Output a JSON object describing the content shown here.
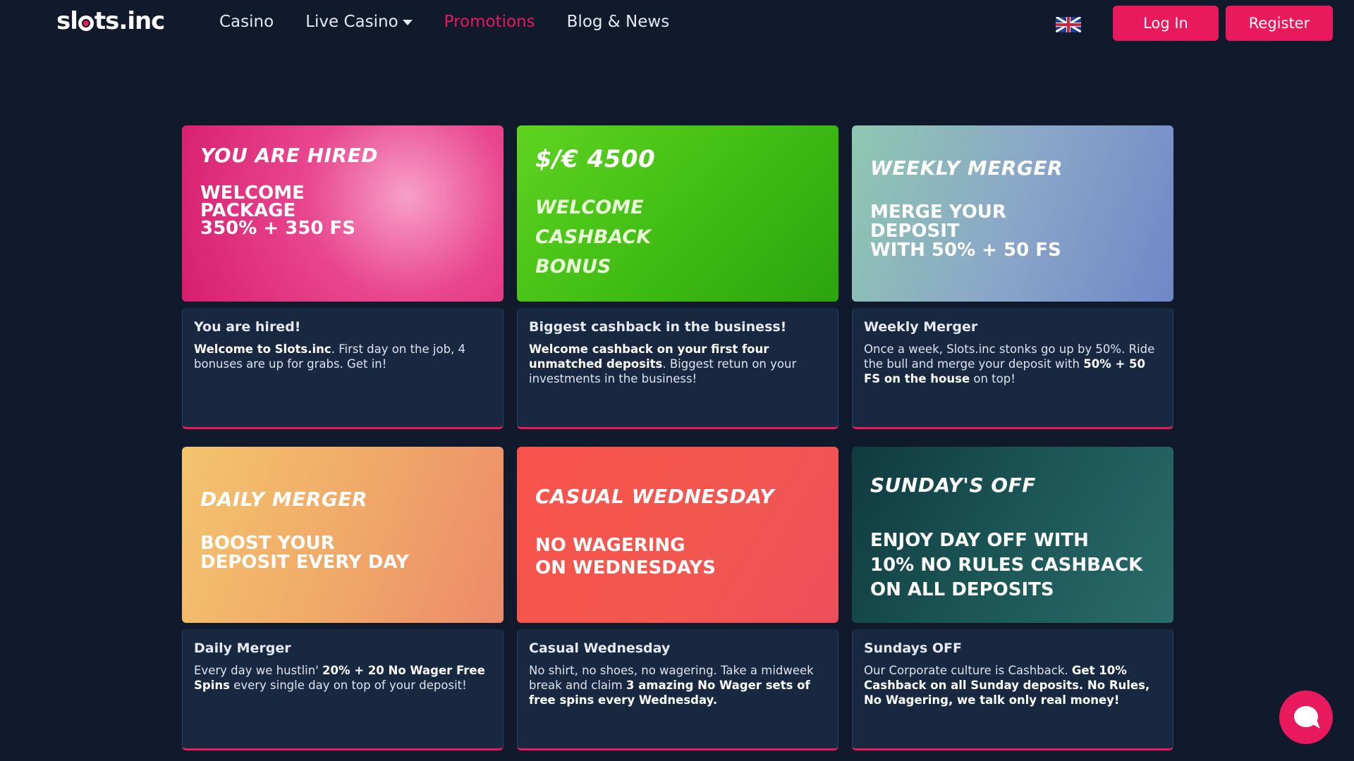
{
  "header": {
    "logo_text": "slots.inc",
    "nav": [
      {
        "label": "Casino"
      },
      {
        "label": "Live Casino"
      },
      {
        "label": "Promotions"
      },
      {
        "label": "Blog & News"
      }
    ],
    "login_label": "Log In",
    "register_label": "Register",
    "language_icon": "uk-flag-icon"
  },
  "promotions": [
    {
      "banner_title": "YOU ARE HIRED",
      "banner_sub": "WELCOME\nPACKAGE\n350% + 350 FS",
      "title": "You are hired!",
      "desc_bold": "Welcome to Slots.inc",
      "desc_rest": ". First day on the job, 4 bonuses are up for grabs. Get in!"
    },
    {
      "banner_title": "$/€ 4500",
      "banner_sub": "WELCOME\nCASHBACK\nBONUS",
      "title": "Biggest cashback in the business!",
      "desc_bold": "Welcome cashback on your first four unmatched deposits",
      "desc_rest": ". Biggest retun on your investments in the business!"
    },
    {
      "banner_title": "WEEKLY MERGER",
      "banner_sub": "MERGE YOUR\nDEPOSIT\nWITH 50% + 50 FS",
      "title": "Weekly Merger",
      "desc_a": "Once a week, Slots.inc stonks go up by 50%. Ride the bull and merge your deposit with ",
      "desc_bold": "50% + 50 FS on the house",
      "desc_rest": " on top!"
    },
    {
      "banner_title": "DAILY MERGER",
      "banner_sub": "BOOST YOUR\nDEPOSIT EVERY DAY",
      "title": "Daily Merger",
      "desc_a": "Every day we hustlin' ",
      "desc_bold": "20% + 20 No Wager Free Spins",
      "desc_rest": " every single day on top of your deposit!"
    },
    {
      "banner_title": "CASUAL WEDNESDAY",
      "banner_sub": "NO WAGERING\nON WEDNESDAYS",
      "title": "Casual Wednesday",
      "desc_a": "No shirt, no shoes, no wagering. Take a midweek break and claim ",
      "desc_bold": "3 amazing No Wager sets of free spins every Wednesday.",
      "desc_rest": ""
    },
    {
      "banner_title": "SUNDAY'S OFF",
      "banner_sub": "ENJOY DAY OFF WITH\n10% NO RULES CASHBACK\nON ALL DEPOSITS",
      "title": "Sundays OFF",
      "desc_a": "Our Corporate culture is Cashback. ",
      "desc_bold": "Get 10% Cashback on all Sunday deposits. No Rules, No Wagering, we talk only real money!",
      "desc_rest": ""
    }
  ],
  "colors": {
    "background": "#111a2c",
    "accent": "#e8195d",
    "card_body": "#172840"
  },
  "chat_icon": "chat-bubble-icon"
}
